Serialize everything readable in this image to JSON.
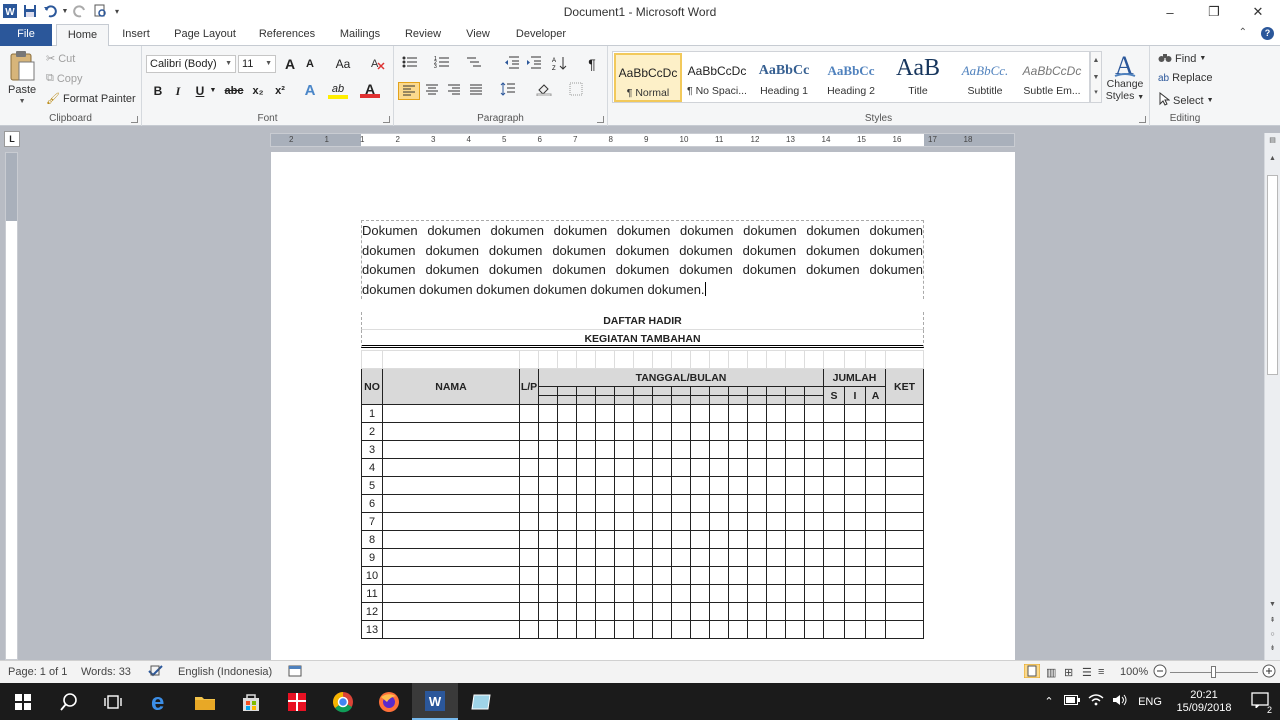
{
  "window": {
    "title": "Document1  -  Microsoft Word",
    "minimize": "–",
    "restore": "❐",
    "close": "✕"
  },
  "tabs": [
    {
      "label": "File"
    },
    {
      "label": "Home"
    },
    {
      "label": "Insert"
    },
    {
      "label": "Page Layout"
    },
    {
      "label": "References"
    },
    {
      "label": "Mailings"
    },
    {
      "label": "Review"
    },
    {
      "label": "View"
    },
    {
      "label": "Developer"
    }
  ],
  "ribbon": {
    "clipboard": {
      "label": "Clipboard",
      "paste": "Paste",
      "cut": "Cut",
      "copy": "Copy",
      "format_painter": "Format Painter"
    },
    "font": {
      "label": "Font",
      "font_name": "Calibri (Body)",
      "font_size": "11",
      "bold": "B",
      "italic": "I",
      "underline": "U",
      "strike": "abc",
      "subscript": "x₂",
      "superscript": "x²",
      "grow": "A",
      "shrink": "A",
      "change_case": "Aa",
      "text_effects": "A",
      "highlight": "ab",
      "font_color": "A",
      "font_color_hex": "#e03131",
      "highlight_hex": "#ffee00"
    },
    "paragraph": {
      "label": "Paragraph",
      "show_marks": "¶"
    },
    "styles": {
      "label": "Styles",
      "items": [
        {
          "preview": "AaBbCcDc",
          "name": "¶ Normal"
        },
        {
          "preview": "AaBbCcDc",
          "name": "¶ No Spaci..."
        },
        {
          "preview": "AaBbCc",
          "name": "Heading 1"
        },
        {
          "preview": "AaBbCc",
          "name": "Heading 2"
        },
        {
          "preview": "AaB",
          "name": "Title"
        },
        {
          "preview": "AaBbCc.",
          "name": "Subtitle"
        },
        {
          "preview": "AaBbCcDc",
          "name": "Subtle Em..."
        }
      ],
      "change_styles_1": "Change",
      "change_styles_2": "Styles"
    },
    "editing": {
      "label": "Editing",
      "find": "Find",
      "replace": "Replace",
      "select": "Select"
    }
  },
  "ruler": {
    "ticks": [
      "2",
      "1",
      "1",
      "2",
      "3",
      "4",
      "5",
      "6",
      "7",
      "8",
      "9",
      "10",
      "11",
      "12",
      "13",
      "14",
      "15",
      "16",
      "17",
      "18"
    ]
  },
  "document": {
    "paragraph": "Dokumen dokumen dokumen dokumen dokumen dokumen dokumen dokumen dokumen dokumen dokumen dokumen dokumen dokumen dokumen dokumen dokumen dokumen dokumen dokumen dokumen dokumen dokumen dokumen dokumen dokumen dokumen dokumen dokumen dokumen dokumen dokumen dokumen.",
    "heading1": "DAFTAR HADIR",
    "heading2": "KEGIATAN TAMBAHAN",
    "table": {
      "no": "NO",
      "nama": "NAMA",
      "lp": "L/P",
      "tanggal": "TANGGAL/BULAN",
      "jumlah": "JUMLAH",
      "s": "S",
      "i": "I",
      "a": "A",
      "ket": "KET",
      "rows": [
        "1",
        "2",
        "3",
        "4",
        "5",
        "6",
        "7",
        "8",
        "9",
        "10",
        "11",
        "12",
        "13"
      ]
    }
  },
  "status": {
    "page": "Page: 1 of 1",
    "words": "Words: 33",
    "language": "English (Indonesia)",
    "zoom": "100%"
  },
  "taskbar": {
    "lang": "ENG",
    "time": "20:21",
    "date": "15/09/2018",
    "notif": "2"
  },
  "colors": {
    "file_tab": "#2b579a",
    "taskbar": "#1b1b1b"
  }
}
